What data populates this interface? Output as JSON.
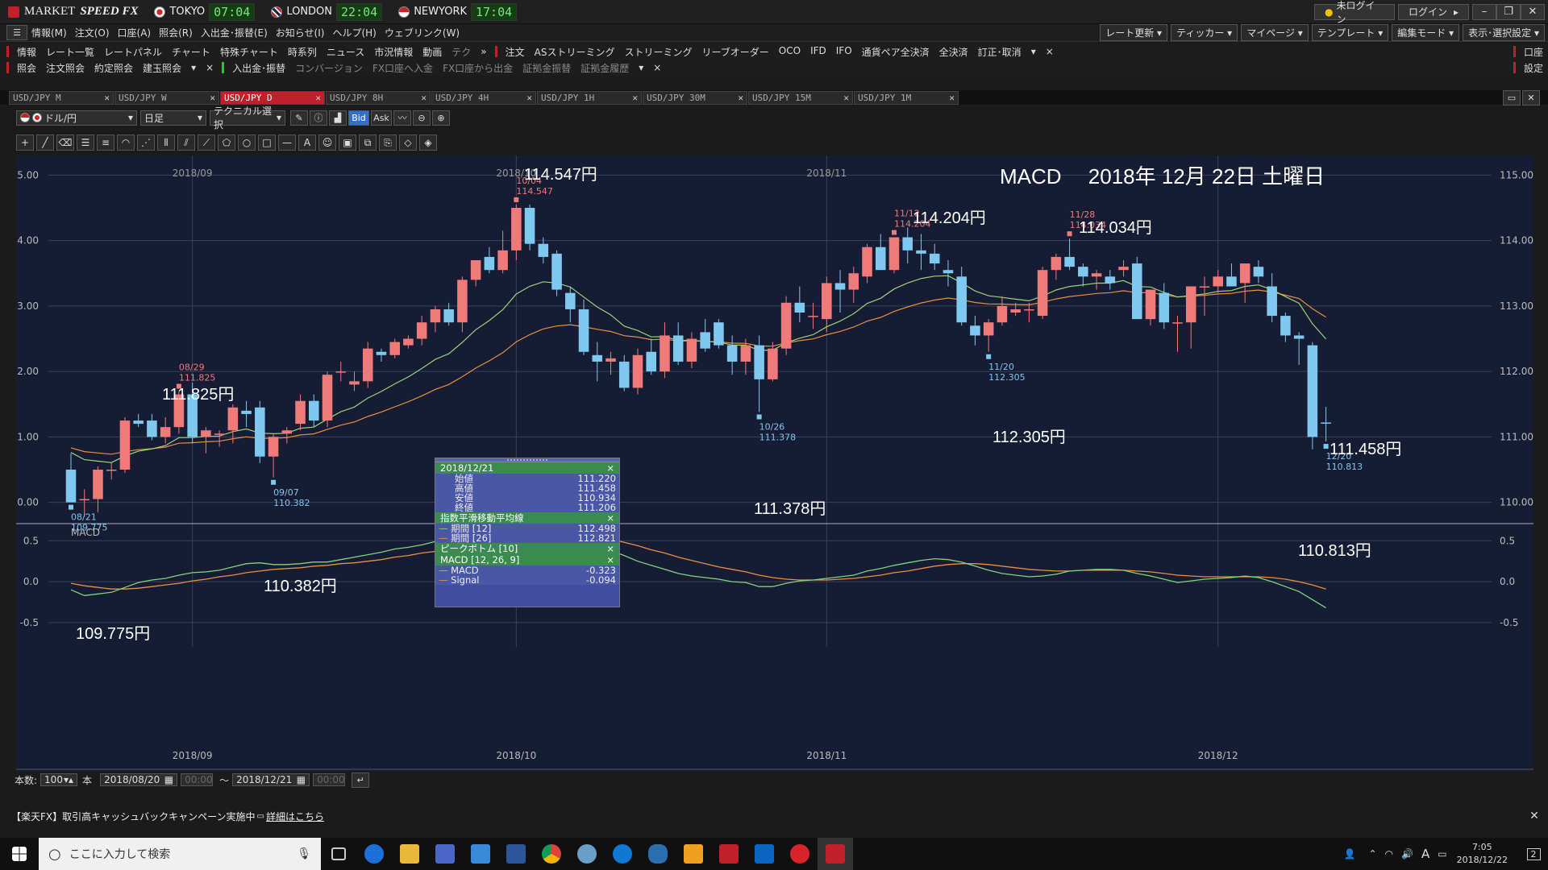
{
  "app": {
    "title_prefix": "MARKET",
    "title_italic": "SPEED FX"
  },
  "clocks": [
    {
      "city": "TOKYO",
      "time": "07:04"
    },
    {
      "city": "LONDON",
      "time": "22:04"
    },
    {
      "city": "NEWYORK",
      "time": "17:04"
    }
  ],
  "title_buttons": {
    "login_status": "未ログイン",
    "login": "ログイン"
  },
  "menu": [
    "情報(M)",
    "注文(O)",
    "口座(A)",
    "照会(R)",
    "入出金･振替(E)",
    "お知らせ(I)",
    "ヘルプ(H)",
    "ウェブリンク(W)"
  ],
  "menu_right": [
    "レート更新",
    "ティッカー",
    "マイページ",
    "テンプレート",
    "編集モード",
    "表示･選択設定"
  ],
  "toolbar1": {
    "group1": "情報",
    "items1": [
      "レート一覧",
      "レートパネル",
      "チャート",
      "特殊チャート",
      "時系列",
      "ニュース",
      "市況情報",
      "動画",
      "テク"
    ],
    "group2": "注文",
    "items2": [
      "ASストリーミング",
      "ストリーミング",
      "リーブオーダー",
      "OCO",
      "IFD",
      "IFO",
      "通貨ペア全決済",
      "全決済",
      "訂正･取消"
    ],
    "right": "口座"
  },
  "toolbar2": {
    "group1": "照会",
    "items1": [
      "注文照会",
      "約定照会",
      "建玉照会"
    ],
    "group2": "入出金･振替",
    "items2": [
      "コンバージョン",
      "FX口座へ入金",
      "FX口座から出金",
      "証拠金振替",
      "証拠金履歴"
    ],
    "right": "設定"
  },
  "tabs": [
    "USD/JPY M",
    "USD/JPY W",
    "USD/JPY D",
    "USD/JPY 8H",
    "USD/JPY 4H",
    "USD/JPY 1H",
    "USD/JPY 30M",
    "USD/JPY 15M",
    "USD/JPY 1M"
  ],
  "active_tab": 2,
  "controls": {
    "pair": "ドル/円",
    "period": "日足",
    "technical": "テクニカル選択",
    "bid": "Bid",
    "ask": "Ask"
  },
  "chart_title": "MACD　 2018年 12月 22日 土曜日",
  "annotations": {
    "p1": "109.775円",
    "p2": "111.825円",
    "p3": "110.382円",
    "p4": "114.547円",
    "p5": "111.378円",
    "p6": "114.204円",
    "p7": "112.305円",
    "p8": "114.034円",
    "p9": "111.458円",
    "p10": "110.813円"
  },
  "marks": [
    {
      "date": "08/21",
      "value": "109.775",
      "color": "#7fc8ef"
    },
    {
      "date": "08/29",
      "value": "111.825",
      "color": "#f07a7a"
    },
    {
      "date": "09/07",
      "value": "110.382",
      "color": "#7fc8ef"
    },
    {
      "date": "10/04",
      "value": "114.547",
      "color": "#f07a7a"
    },
    {
      "date": "10/26",
      "value": "111.378",
      "color": "#7fc8ef"
    },
    {
      "date": "11/12",
      "value": "114.204",
      "color": "#f07a7a"
    },
    {
      "date": "11/20",
      "value": "112.305",
      "color": "#7fc8ef"
    },
    {
      "date": "11/28",
      "value": "114.034",
      "color": "#f07a7a"
    },
    {
      "date": "12/20",
      "value": "110.813",
      "color": "#7fc8ef"
    }
  ],
  "info": {
    "date": "2018/12/21",
    "ohlc": [
      {
        "k": "始値",
        "v": "111.220"
      },
      {
        "k": "高値",
        "v": "111.458"
      },
      {
        "k": "安値",
        "v": "110.934"
      },
      {
        "k": "終値",
        "v": "111.206"
      }
    ],
    "ema_title": "指数平滑移動平均線",
    "ema": [
      {
        "k": "期間 [12]",
        "v": "112.498"
      },
      {
        "k": "期間 [26]",
        "v": "112.821"
      }
    ],
    "peak_title": "ピークボトム [10]",
    "macd_title": "MACD [12, 26, 9]",
    "macd": [
      {
        "k": "MACD",
        "v": "-0.323"
      },
      {
        "k": "Signal",
        "v": "-0.094"
      }
    ]
  },
  "macd_label": "MACD",
  "bottom": {
    "count_label": "本数:",
    "count": "100",
    "unit": "本",
    "from": "2018/08/20",
    "from_time": "00:00",
    "to": "2018/12/21",
    "to_time": "00:00",
    "tilde": "〜"
  },
  "news": "【楽天FX】取引高キャッシュバックキャンペーン実施中",
  "news_link": "詳細はこちら",
  "taskbar": {
    "search": "ここに入力して検索",
    "time": "7:05",
    "date": "2018/12/22",
    "notif": "2"
  },
  "chart_data": {
    "type": "candlestick",
    "title": "MACD　 2018年 12月 22日 土曜日",
    "price_ylim": [
      109.7,
      115.3
    ],
    "price_ticks": [
      "115.00",
      "114.00",
      "113.00",
      "112.00",
      "111.00",
      "110.00"
    ],
    "macd_ylim": [
      -0.6,
      0.7
    ],
    "macd_ticks": [
      "0.5",
      "0.0",
      "-0.5"
    ],
    "x_labels": [
      "2018/09",
      "2018/10",
      "2018/11",
      "2018/12"
    ],
    "candles": [
      [
        110.5,
        110.75,
        110.0,
        110.0
      ],
      [
        110.05,
        110.2,
        109.78,
        110.05
      ],
      [
        110.05,
        110.55,
        109.85,
        110.5
      ],
      [
        110.5,
        110.6,
        110.35,
        110.5
      ],
      [
        110.5,
        111.3,
        110.45,
        111.25
      ],
      [
        111.25,
        111.35,
        111.15,
        111.2
      ],
      [
        111.25,
        111.35,
        110.95,
        111.0
      ],
      [
        111.0,
        111.3,
        110.9,
        111.15
      ],
      [
        111.15,
        111.7,
        111.05,
        111.65
      ],
      [
        111.65,
        111.83,
        110.9,
        111.0
      ],
      [
        111.0,
        111.15,
        110.75,
        111.1
      ],
      [
        111.05,
        111.1,
        110.85,
        111.05
      ],
      [
        111.1,
        111.5,
        110.9,
        111.45
      ],
      [
        111.4,
        111.55,
        111.15,
        111.35
      ],
      [
        111.45,
        111.55,
        110.6,
        110.7
      ],
      [
        110.7,
        111.05,
        110.38,
        111.0
      ],
      [
        111.05,
        111.15,
        110.9,
        111.1
      ],
      [
        111.2,
        111.65,
        111.1,
        111.55
      ],
      [
        111.55,
        111.65,
        111.15,
        111.25
      ],
      [
        111.25,
        112.0,
        111.15,
        111.95
      ],
      [
        112.0,
        112.15,
        111.85,
        112.0
      ],
      [
        111.8,
        112.0,
        111.7,
        111.85
      ],
      [
        111.85,
        112.45,
        111.75,
        112.35
      ],
      [
        112.3,
        112.35,
        112.15,
        112.25
      ],
      [
        112.25,
        112.5,
        112.2,
        112.45
      ],
      [
        112.4,
        112.55,
        112.35,
        112.5
      ],
      [
        112.5,
        112.85,
        112.4,
        112.75
      ],
      [
        112.75,
        113.0,
        112.6,
        112.95
      ],
      [
        112.95,
        113.05,
        112.7,
        112.75
      ],
      [
        112.75,
        113.45,
        112.6,
        113.4
      ],
      [
        113.4,
        113.7,
        113.3,
        113.7
      ],
      [
        113.75,
        113.9,
        113.5,
        113.55
      ],
      [
        113.55,
        114.15,
        113.5,
        113.85
      ],
      [
        113.85,
        114.55,
        113.7,
        114.5
      ],
      [
        114.5,
        114.55,
        113.85,
        113.95
      ],
      [
        113.95,
        114.05,
        113.65,
        113.75
      ],
      [
        113.8,
        113.85,
        113.15,
        113.25
      ],
      [
        113.2,
        113.3,
        112.75,
        112.95
      ],
      [
        112.95,
        113.1,
        112.25,
        112.3
      ],
      [
        112.25,
        112.45,
        111.85,
        112.15
      ],
      [
        112.15,
        112.3,
        111.95,
        112.2
      ],
      [
        112.15,
        112.25,
        111.7,
        111.75
      ],
      [
        111.75,
        112.35,
        111.65,
        112.25
      ],
      [
        112.3,
        112.5,
        111.95,
        112.0
      ],
      [
        112.0,
        112.75,
        111.9,
        112.55
      ],
      [
        112.55,
        112.75,
        112.1,
        112.15
      ],
      [
        112.15,
        112.6,
        112.05,
        112.5
      ],
      [
        112.6,
        112.8,
        112.3,
        112.35
      ],
      [
        112.75,
        112.8,
        112.35,
        112.4
      ],
      [
        112.4,
        112.55,
        111.95,
        112.15
      ],
      [
        112.15,
        112.5,
        111.95,
        112.4
      ],
      [
        112.4,
        112.55,
        111.38,
        111.88
      ],
      [
        111.88,
        112.45,
        111.85,
        112.35
      ],
      [
        112.35,
        113.15,
        112.25,
        113.05
      ],
      [
        113.05,
        113.3,
        112.75,
        112.9
      ],
      [
        112.85,
        113.05,
        112.65,
        112.85
      ],
      [
        112.8,
        113.45,
        112.6,
        113.35
      ],
      [
        113.35,
        113.55,
        112.9,
        113.25
      ],
      [
        113.25,
        113.6,
        113.05,
        113.5
      ],
      [
        113.45,
        113.95,
        113.35,
        113.9
      ],
      [
        113.9,
        114.1,
        113.55,
        113.55
      ],
      [
        113.55,
        114.05,
        113.5,
        114.05
      ],
      [
        114.05,
        114.2,
        113.65,
        113.85
      ],
      [
        113.85,
        114.1,
        113.55,
        113.8
      ],
      [
        113.8,
        113.95,
        113.55,
        113.65
      ],
      [
        113.55,
        113.7,
        113.3,
        113.5
      ],
      [
        113.45,
        113.6,
        112.7,
        112.75
      ],
      [
        112.7,
        112.85,
        112.4,
        112.55
      ],
      [
        112.55,
        112.8,
        112.3,
        112.75
      ],
      [
        112.75,
        113.15,
        112.7,
        113.0
      ],
      [
        112.9,
        113.05,
        112.85,
        112.95
      ],
      [
        112.95,
        113.05,
        112.75,
        112.95
      ],
      [
        112.85,
        113.6,
        112.8,
        113.55
      ],
      [
        113.55,
        113.8,
        113.4,
        113.75
      ],
      [
        113.75,
        114.03,
        113.55,
        113.6
      ],
      [
        113.6,
        113.65,
        113.3,
        113.45
      ],
      [
        113.45,
        113.55,
        113.25,
        113.5
      ],
      [
        113.45,
        113.55,
        113.25,
        113.35
      ],
      [
        113.55,
        113.7,
        113.45,
        113.6
      ],
      [
        113.65,
        113.75,
        112.9,
        112.8
      ],
      [
        112.8,
        113.25,
        112.7,
        113.25
      ],
      [
        113.2,
        113.35,
        112.65,
        112.75
      ],
      [
        112.75,
        112.85,
        112.3,
        112.75
      ],
      [
        112.75,
        113.15,
        112.35,
        113.3
      ],
      [
        113.3,
        113.45,
        112.85,
        113.3
      ],
      [
        113.3,
        113.55,
        113.2,
        113.45
      ],
      [
        113.45,
        113.65,
        113.35,
        113.3
      ],
      [
        113.35,
        113.65,
        113.05,
        113.65
      ],
      [
        113.6,
        113.7,
        113.35,
        113.45
      ],
      [
        113.3,
        113.5,
        112.75,
        112.85
      ],
      [
        112.85,
        112.9,
        112.45,
        112.55
      ],
      [
        112.55,
        112.6,
        112.1,
        112.5
      ],
      [
        112.4,
        112.45,
        110.81,
        111.0
      ],
      [
        111.22,
        111.46,
        110.93,
        111.21
      ]
    ],
    "macd_series": [
      {
        "name": "MACD",
        "values": [
          -0.1,
          -0.17,
          -0.15,
          -0.13,
          -0.07,
          -0.01,
          0.02,
          0.04,
          0.08,
          0.11,
          0.12,
          0.14,
          0.18,
          0.22,
          0.23,
          0.21,
          0.21,
          0.22,
          0.24,
          0.24,
          0.27,
          0.3,
          0.33,
          0.36,
          0.4,
          0.42,
          0.45,
          0.49,
          0.52,
          0.56,
          0.6,
          0.62,
          0.62,
          0.67,
          0.69,
          0.67,
          0.63,
          0.57,
          0.5,
          0.44,
          0.38,
          0.32,
          0.25,
          0.2,
          0.15,
          0.1,
          0.07,
          0.05,
          0.03,
          0.0,
          -0.01,
          -0.06,
          -0.06,
          -0.02,
          0.01,
          0.02,
          0.04,
          0.06,
          0.08,
          0.13,
          0.16,
          0.2,
          0.23,
          0.26,
          0.28,
          0.27,
          0.24,
          0.19,
          0.14,
          0.1,
          0.08,
          0.06,
          0.07,
          0.09,
          0.13,
          0.14,
          0.15,
          0.15,
          0.14,
          0.1,
          0.07,
          0.03,
          -0.01,
          0.01,
          0.03,
          0.04,
          0.05,
          0.07,
          0.05,
          0.0,
          -0.06,
          -0.12,
          -0.22,
          -0.32
        ]
      },
      {
        "name": "Signal",
        "values": [
          -0.02,
          -0.05,
          -0.07,
          -0.09,
          -0.09,
          -0.08,
          -0.06,
          -0.04,
          -0.02,
          0.01,
          0.03,
          0.06,
          0.08,
          0.11,
          0.13,
          0.15,
          0.16,
          0.17,
          0.19,
          0.2,
          0.22,
          0.23,
          0.25,
          0.27,
          0.3,
          0.32,
          0.35,
          0.37,
          0.4,
          0.43,
          0.46,
          0.49,
          0.52,
          0.54,
          0.57,
          0.59,
          0.6,
          0.59,
          0.58,
          0.55,
          0.52,
          0.48,
          0.44,
          0.39,
          0.35,
          0.3,
          0.26,
          0.22,
          0.18,
          0.15,
          0.12,
          0.08,
          0.05,
          0.03,
          0.02,
          0.02,
          0.02,
          0.03,
          0.04,
          0.06,
          0.08,
          0.11,
          0.13,
          0.16,
          0.19,
          0.21,
          0.22,
          0.22,
          0.21,
          0.19,
          0.17,
          0.15,
          0.14,
          0.13,
          0.13,
          0.14,
          0.14,
          0.14,
          0.14,
          0.13,
          0.12,
          0.1,
          0.08,
          0.07,
          0.06,
          0.06,
          0.06,
          0.06,
          0.06,
          0.05,
          0.03,
          0.0,
          -0.04,
          -0.09
        ]
      }
    ]
  }
}
